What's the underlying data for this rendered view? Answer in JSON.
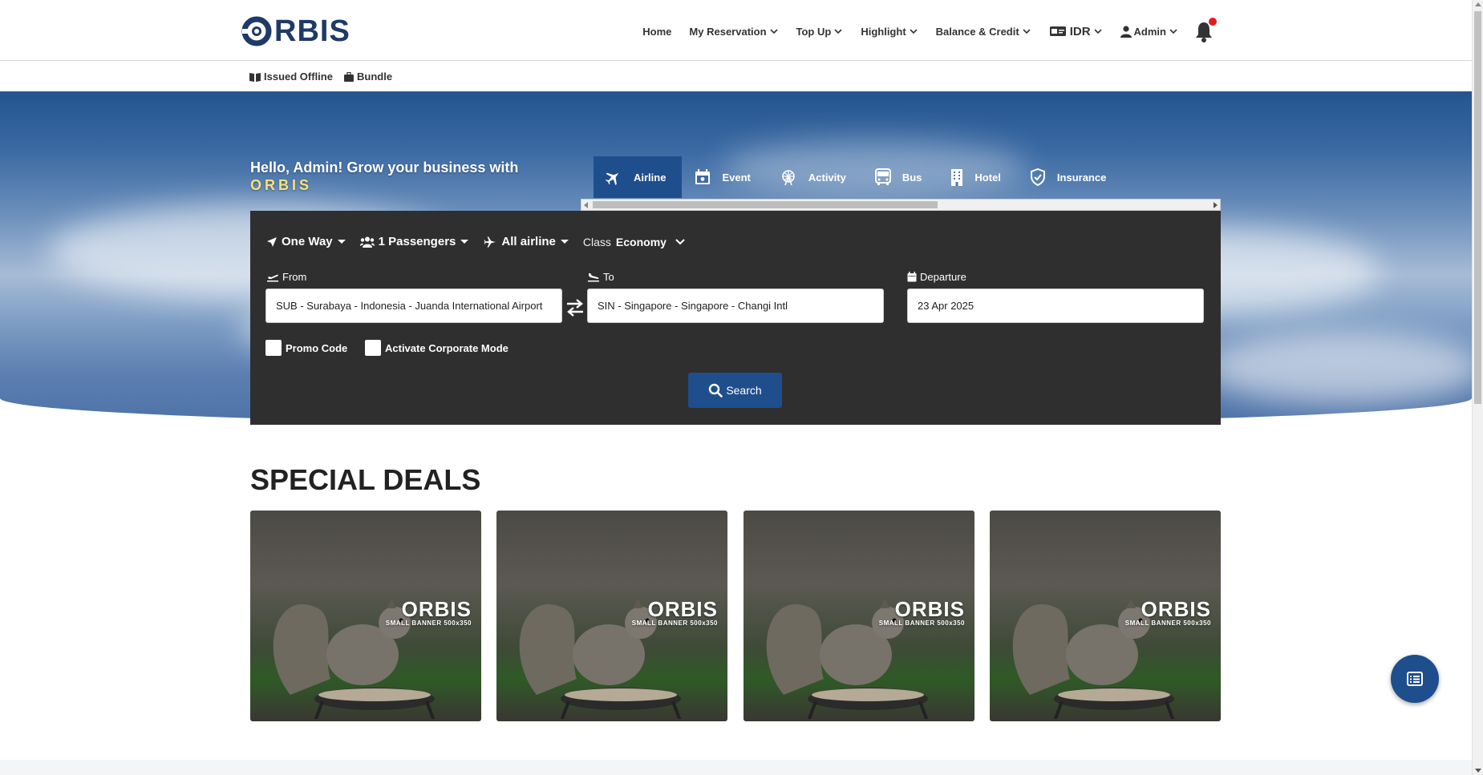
{
  "brand": {
    "logo_text": "RBIS",
    "logo_icon": "orbis-ring-logo",
    "color": "#1f3a66"
  },
  "nav": {
    "items": [
      {
        "label": "Home",
        "dropdown": false
      },
      {
        "label": "My Reservation",
        "dropdown": true
      },
      {
        "label": "Top Up",
        "dropdown": true
      },
      {
        "label": "Highlight",
        "dropdown": true
      },
      {
        "label": "Balance & Credit",
        "dropdown": true
      }
    ],
    "currency": {
      "label": "IDR",
      "icon": "currency-card-icon"
    },
    "user": {
      "label": "Admin",
      "icon": "user-icon"
    },
    "notification": {
      "icon": "bell-icon",
      "has_unread": true
    }
  },
  "subnav": [
    {
      "label": "Issued Offline",
      "icon": "book-icon"
    },
    {
      "label": "Bundle",
      "icon": "suitcase-icon"
    }
  ],
  "hero": {
    "greeting": "Hello, Admin! Grow your business with",
    "brand_word": "ORBIS",
    "tabs": [
      {
        "label": "Airline",
        "icon": "plane-icon",
        "active": true
      },
      {
        "label": "Event",
        "icon": "calendar-icon",
        "active": false
      },
      {
        "label": "Activity",
        "icon": "ferris-wheel-icon",
        "active": false
      },
      {
        "label": "Bus",
        "icon": "bus-icon",
        "active": false
      },
      {
        "label": "Hotel",
        "icon": "building-icon",
        "active": false
      },
      {
        "label": "Insurance",
        "icon": "shield-icon",
        "active": false
      }
    ]
  },
  "search": {
    "trip_type": "One Way",
    "passengers": "1 Passengers",
    "airline": "All airline",
    "class_label": "Class",
    "class_value": "Economy",
    "from_label": "From",
    "from_value": "SUB - Surabaya - Indonesia - Juanda International Airport",
    "to_label": "To",
    "to_value": "SIN - Singapore - Singapore - Changi Intl",
    "departure_label": "Departure",
    "departure_value": "23 Apr 2025",
    "promo_label": "Promo Code",
    "promo_checked": false,
    "corporate_label": "Activate Corporate Mode",
    "corporate_checked": false,
    "button_label": "Search"
  },
  "deals": {
    "title": "SPECIAL DEALS",
    "cards": [
      {
        "brand": "ORBIS",
        "caption": "SMALL BANNER 500x350"
      },
      {
        "brand": "ORBIS",
        "caption": "SMALL BANNER 500x350"
      },
      {
        "brand": "ORBIS",
        "caption": "SMALL BANNER 500x350"
      },
      {
        "brand": "ORBIS",
        "caption": "SMALL BANNER 500x350"
      }
    ]
  },
  "fab": {
    "icon": "list-icon"
  },
  "colors": {
    "primary": "#1f4e8c",
    "panel": "#2f2f2f",
    "notification": "#e41c1c",
    "brand_accent": "#f7e27a"
  }
}
